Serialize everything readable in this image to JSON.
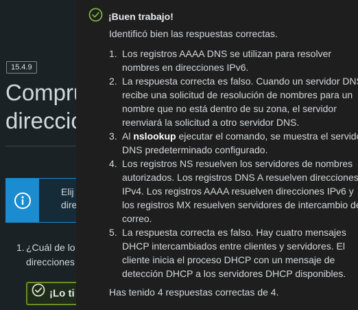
{
  "background": {
    "version_badge": "15.4.9",
    "title_line1": "Compru",
    "title_line2": "direccio",
    "info_text_line1": "Elij",
    "info_text_line2": "dire",
    "question_number": "1.",
    "question_line1": "¿Cuál de lo",
    "question_line2": "direcciones",
    "feedback_text": "¡Lo ti"
  },
  "popover": {
    "title": "¡Buen trabajo!",
    "intro": "Identificó bien las respuestas correctas.",
    "answers": [
      {
        "text": "Los registros AAAA DNS se utilizan para resolver nombres en direcciones IPv6."
      },
      {
        "text": "La respuesta correcta es falso. Cuando un servidor DNS recibe una solicitud de resolución de nombres para un nombre que no está dentro de su zona, el servidor reenviará la solicitud a otro servidor DNS."
      },
      {
        "pre": "Al ",
        "bold": "nslookup",
        "post": " ejecutar el comando, se muestra el servidor DNS predeterminado configurado."
      },
      {
        "text": "Los registros NS resuelven los servidores de nombres autorizados. Los registros DNS A resuelven direcciones IPv4. Los registros AAAA resuelven direcciones IPv6 y los registros MX resuelven servidores de intercambio de correo."
      },
      {
        "text": "La respuesta correcta es falso. Hay cuatro mensajes DHCP intercambiados entre clientes y servidores. El cliente inicia el proceso DHCP con un mensaje de detección DHCP a los servidores DHCP disponibles."
      }
    ],
    "score": "Has tenido 4 respuestas correctas de 4."
  },
  "colors": {
    "success": "#6b8e23",
    "info": "#1b8ccf",
    "popover_bg": "#1e1e1e"
  },
  "icons": {
    "header": "check-circle-icon",
    "info": "info-circle-icon",
    "feedback": "check-circle-icon"
  }
}
